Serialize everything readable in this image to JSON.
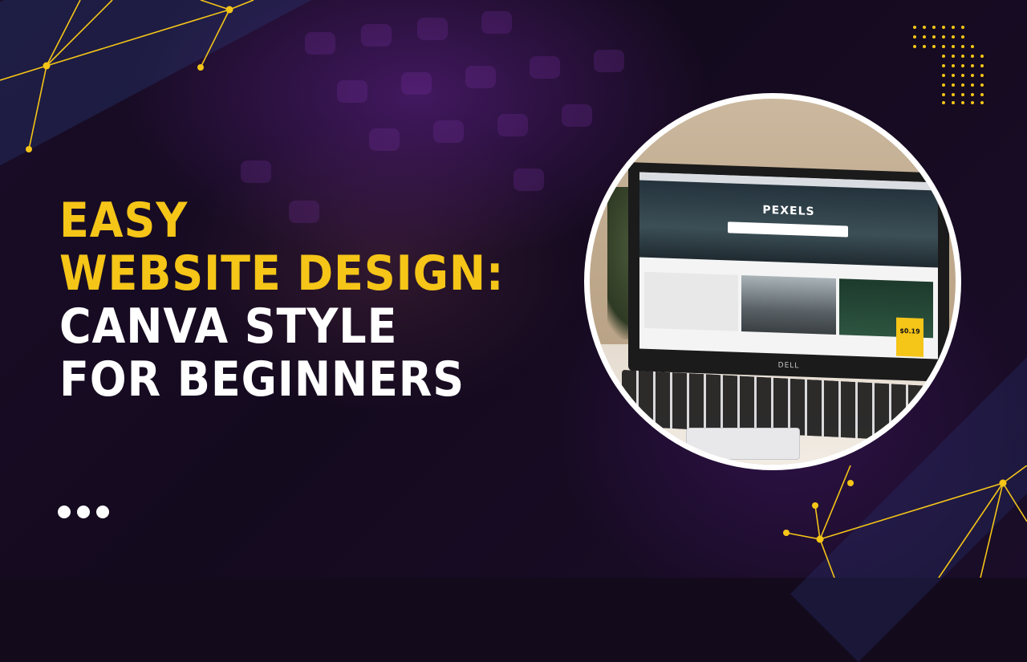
{
  "headline": {
    "line1": "EASY",
    "line2": "WEBSITE DESIGN:",
    "line3": "CANVA STYLE",
    "line4": "FOR BEGINNERS"
  },
  "colors": {
    "accent": "#f5c518",
    "text": "#ffffff",
    "background": "#130a1c"
  },
  "photo": {
    "screen_title": "PEXELS",
    "laptop_brand": "DELL",
    "ad_price": "$0.19"
  },
  "icons": [
    "network-lines-icon",
    "dot-grid-icon",
    "more-dots-icon"
  ]
}
